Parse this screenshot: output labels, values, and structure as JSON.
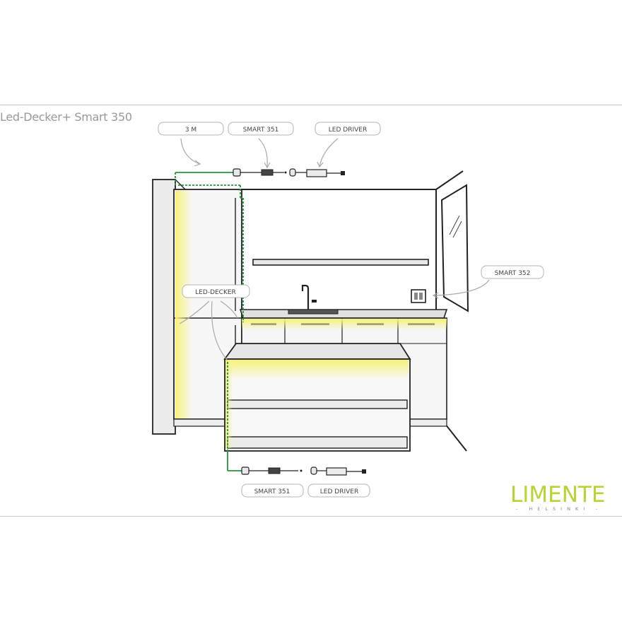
{
  "title": "Led-Decker+ Smart 350",
  "labels": {
    "length": "3 M",
    "smart351_top": "SMART 351",
    "driver_top": "LED DRIVER",
    "smart352": "SMART 352",
    "led_decker": "LED-DECKER",
    "smart351_bottom": "SMART 351",
    "driver_bottom": "LED DRIVER"
  },
  "logo": {
    "word": "LIMENTE",
    "sub": "- HELSINKI -"
  },
  "colors": {
    "cable": "#1f9a3a",
    "led_glow": "#f4f08a",
    "logo": "#b8d432",
    "line": "#222222"
  }
}
